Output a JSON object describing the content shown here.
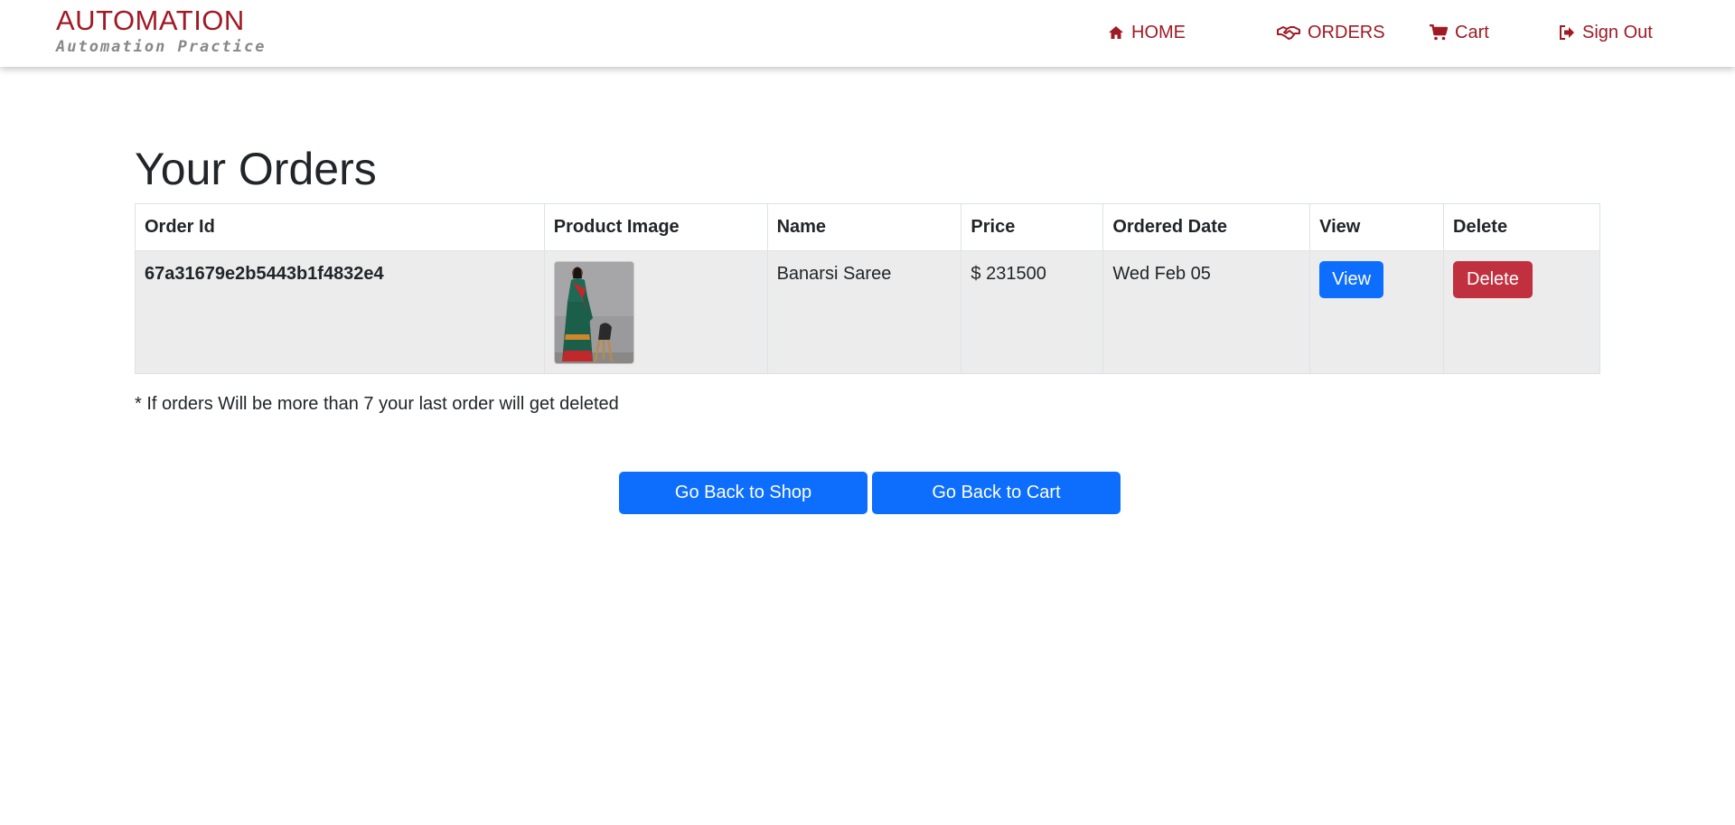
{
  "brand": {
    "title": "AUTOMATION",
    "subtitle": "Automation Practice",
    "color": "#a01a24"
  },
  "nav": {
    "items": [
      {
        "label": "HOME",
        "icon": "home-icon"
      },
      {
        "label": "ORDERS",
        "icon": "handshake-icon"
      },
      {
        "label": "Cart",
        "icon": "shopping-cart-icon"
      },
      {
        "label": "Sign Out",
        "icon": "sign-out-icon"
      }
    ]
  },
  "main": {
    "title": "Your Orders",
    "table": {
      "headers": [
        "Order Id",
        "Product Image",
        "Name",
        "Price",
        "Ordered Date",
        "View",
        "Delete"
      ],
      "rows": [
        {
          "order_id": "67a31679e2b5443b1f4832e4",
          "product_image": "product-thumbnail",
          "name": "Banarsi Saree",
          "price": "$ 231500",
          "ordered_date": "Wed Feb 05",
          "view_label": "View",
          "delete_label": "Delete"
        }
      ]
    },
    "note": "* If orders Will be more than 7 your last order will get deleted",
    "buttons": {
      "back_to_shop": "Go Back to Shop",
      "back_to_cart": "Go Back to Cart"
    }
  },
  "colors": {
    "primary": "#0d6efd",
    "danger": "#c0303f",
    "row_bg": "#ececec"
  }
}
